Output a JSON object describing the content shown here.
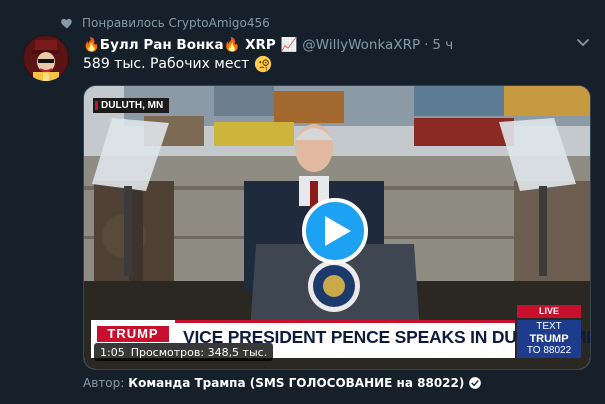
{
  "social_context": {
    "text": "Понравилось CryptoAmigo456",
    "icon": "heart-icon"
  },
  "tweet": {
    "display_name": "🔥Булл Ран Вонка🔥 XRP 📈",
    "handle": "@WillyWonkaXRP",
    "separator": "·",
    "time": "5 ч",
    "text": "589 тыс. Рабочих мест",
    "text_emoji": "face-with-monocle-emoji"
  },
  "video": {
    "location_tag": "DULUTH, MN",
    "network_logo": "TRUMP",
    "headline": "VICE PRESIDENT PENCE SPEAKS IN DULUTH, MINNESOTA",
    "live_label": "LIVE",
    "sms_box": {
      "line1": "TEXT",
      "line2": "TRUMP",
      "line3": "TO 88022"
    },
    "duration": "1:05",
    "views": "Просмотров: 348,5 тыс."
  },
  "author_attribution": {
    "label": "Автор:",
    "name": "Команда Трампа (SMS ГОЛОСОВАНИЕ на 88022)"
  },
  "colors": {
    "background": "#15202b",
    "secondary_text": "#8899a6",
    "accent": "#1da1f2",
    "live_red": "#c8102e",
    "navy": "#1d3c8c"
  }
}
